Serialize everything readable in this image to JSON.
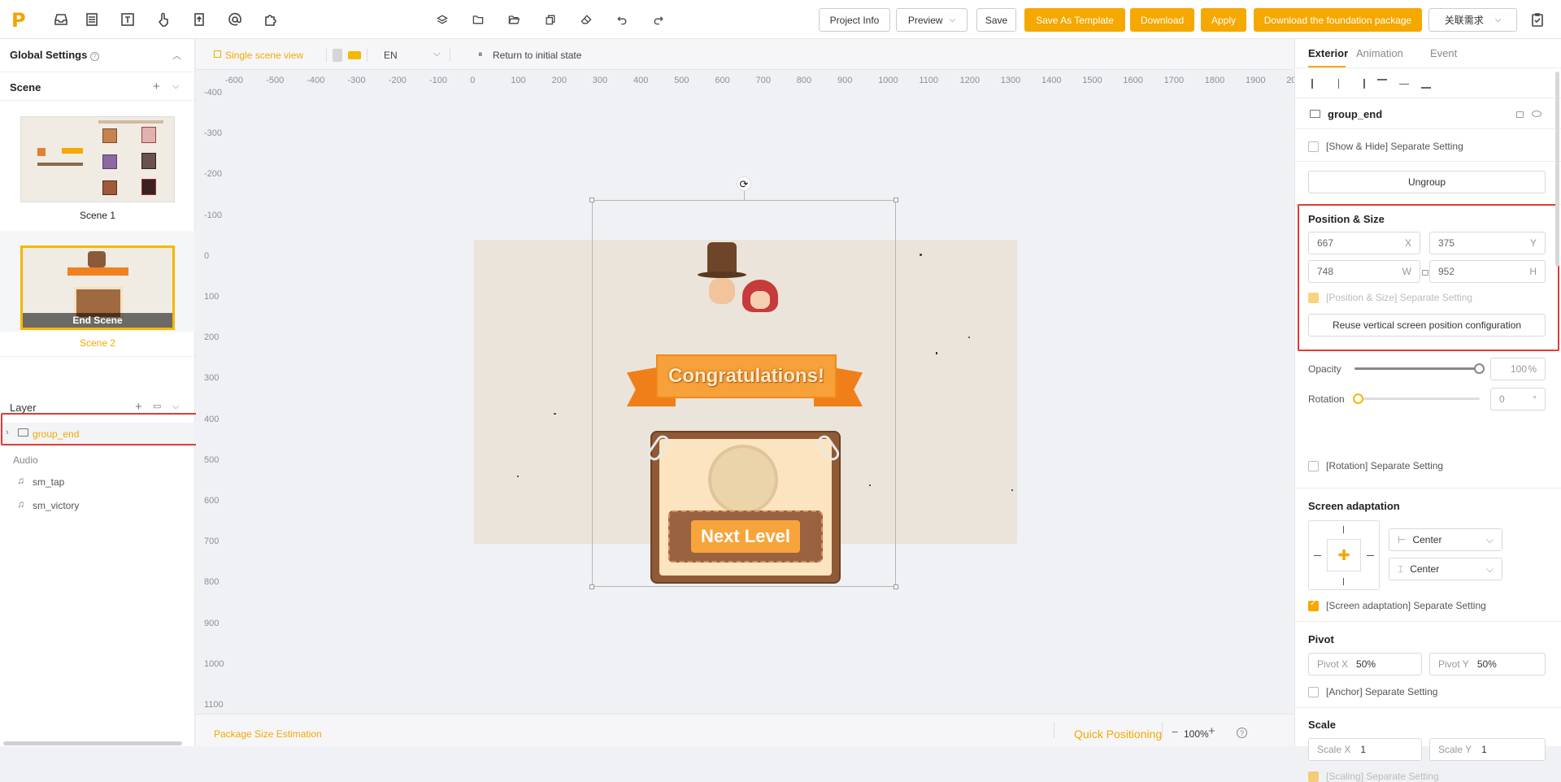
{
  "topbar": {
    "buttons": {
      "project_info": "Project Info",
      "preview": "Preview",
      "save": "Save",
      "save_template": "Save As Template",
      "download": "Download",
      "apply": "Apply",
      "download_foundation": "Download the foundation package",
      "related": "关联需求"
    },
    "logo": "P"
  },
  "left": {
    "global_settings": "Global Settings",
    "scene_title": "Scene",
    "scenes": [
      {
        "label": "Scene 1"
      },
      {
        "label": "Scene 2",
        "overlay": "End Scene"
      }
    ],
    "layer_title": "Layer",
    "layers": [
      {
        "label": "group_end"
      }
    ],
    "audio_title": "Audio",
    "audio": [
      {
        "label": "sm_tap"
      },
      {
        "label": "sm_victory"
      }
    ]
  },
  "canvas": {
    "single_scene": "Single scene view",
    "language": "EN",
    "return_initial": "Return to initial state",
    "ruler_h": [
      "-600",
      "-500",
      "-400",
      "-300",
      "-200",
      "-100",
      "0",
      "100",
      "200",
      "300",
      "400",
      "500",
      "600",
      "700",
      "800",
      "900",
      "1000",
      "1100",
      "1200",
      "1300",
      "1400",
      "1500",
      "1600",
      "1700",
      "1800",
      "1900",
      "20"
    ],
    "ruler_v": [
      "-400",
      "-300",
      "-200",
      "-100",
      "0",
      "100",
      "200",
      "300",
      "400",
      "500",
      "600",
      "700",
      "800",
      "900",
      "1000",
      "1100"
    ],
    "banner": "Congratulations!",
    "button": "Next Level",
    "package_size": "Package Size Estimation",
    "quick_positioning": "Quick Positioning",
    "zoom": "100%"
  },
  "right": {
    "tabs": [
      "Exterior",
      "Animation",
      "Event"
    ],
    "element_name": "group_end",
    "show_hide": "[Show & Hide] Separate Setting",
    "ungroup": "Ungroup",
    "pos_size": "Position & Size",
    "x": "667",
    "x_label": "X",
    "y": "375",
    "y_label": "Y",
    "w": "748",
    "w_label": "W",
    "h_val": "952",
    "h_label": "H",
    "pos_sep": "[Position & Size] Separate Setting",
    "reuse": "Reuse vertical screen position configuration",
    "opacity_label": "Opacity",
    "opacity": "100",
    "opacity_unit": "%",
    "opacity_level": 1.0,
    "rotation_label": "Rotation",
    "rotation": "0",
    "rotation_unit": "°",
    "rotation_sep": "[Rotation] Separate Setting",
    "screen_adapt": "Screen adaptation",
    "h_align": "Center",
    "v_align": "Center",
    "screen_sep": "[Screen adaptation] Separate Setting",
    "pivot": "Pivot",
    "pivot_x_label": "Pivot X",
    "pivot_x": "50%",
    "pivot_y_label": "Pivot Y",
    "pivot_y": "50%",
    "anchor_sep": "[Anchor] Separate Setting",
    "scale": "Scale",
    "scale_x_label": "Scale X",
    "scale_x": "1",
    "scale_y_label": "Scale Y",
    "scale_y": "1",
    "scale_sep": "[Scaling] Separate Setting"
  },
  "colors": {
    "accent": "#f5a800",
    "highlight": "#e53935"
  }
}
